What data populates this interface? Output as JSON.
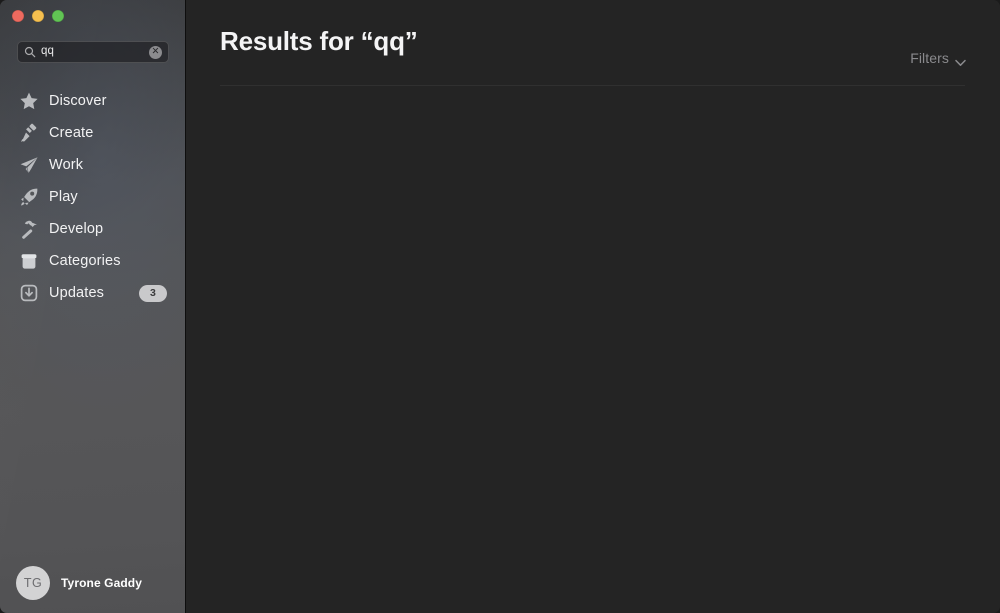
{
  "window": {
    "traffic_lights": [
      {
        "name": "close",
        "color": "#ed6a5f"
      },
      {
        "name": "minimize",
        "color": "#f5bf4f"
      },
      {
        "name": "zoom",
        "color": "#61c454"
      }
    ]
  },
  "search": {
    "value": "qq",
    "placeholder": "Search",
    "icon": "search-icon",
    "clear_icon": "clear-circle-icon",
    "clear_glyph": "✕"
  },
  "sidebar": {
    "items": [
      {
        "label": "Discover",
        "icon": "star-icon"
      },
      {
        "label": "Create",
        "icon": "paintbrush-icon"
      },
      {
        "label": "Work",
        "icon": "paper-plane-icon"
      },
      {
        "label": "Play",
        "icon": "rocket-icon"
      },
      {
        "label": "Develop",
        "icon": "hammer-icon"
      },
      {
        "label": "Categories",
        "icon": "box-icon"
      },
      {
        "label": "Updates",
        "icon": "download-icon",
        "badge": "3"
      }
    ],
    "account": {
      "initials": "TG",
      "name": "Tyrone Gaddy"
    }
  },
  "main": {
    "title": "Results for “qq”",
    "filters": {
      "label": "Filters",
      "icon": "chevron-down-icon"
    }
  },
  "colors": {
    "sidebar_bg": "#545557",
    "content_bg": "#242424",
    "text_primary": "#f2f2f3",
    "text_muted": "#8a8a8d",
    "badge_bg": "#c9c9cb",
    "avatar_bg": "#d3d3d4"
  }
}
